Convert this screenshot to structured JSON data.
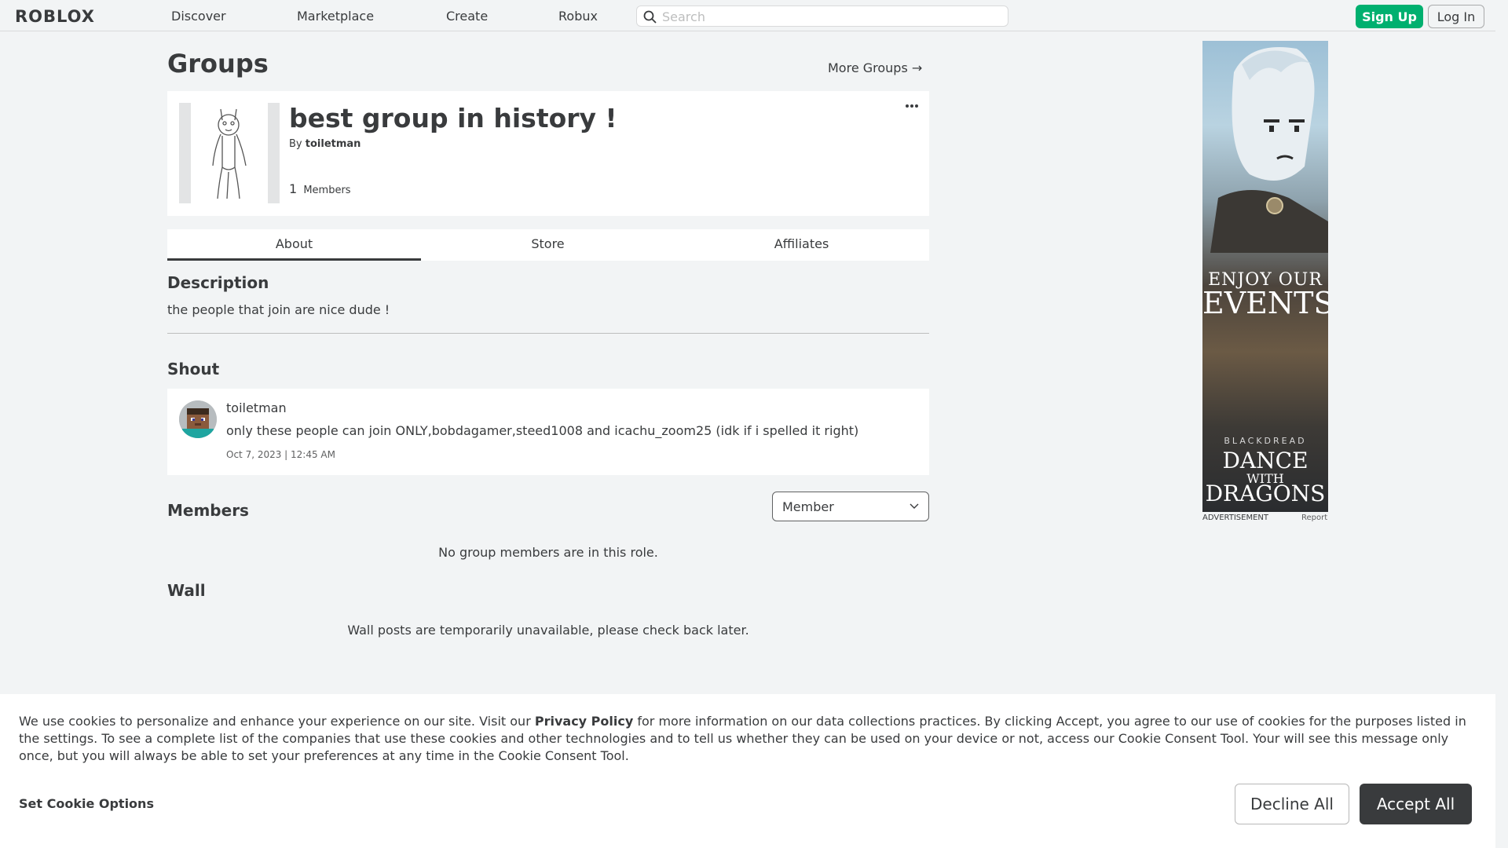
{
  "nav": {
    "logo": "ROBLOX",
    "items": [
      "Discover",
      "Marketplace",
      "Create",
      "Robux"
    ],
    "search_placeholder": "Search",
    "signup_label": "Sign Up",
    "login_label": "Log In"
  },
  "header": {
    "title": "Groups",
    "more_groups": "More Groups →"
  },
  "group": {
    "name": "best group in history !",
    "by_prefix": "By",
    "owner": "toiletman",
    "member_count": "1",
    "members_label": "Members"
  },
  "tabs": [
    {
      "label": "About",
      "active": true
    },
    {
      "label": "Store",
      "active": false
    },
    {
      "label": "Affiliates",
      "active": false
    }
  ],
  "about": {
    "description_title": "Description",
    "description": "the people that join are nice dude !",
    "shout_title": "Shout",
    "shout": {
      "user": "toiletman",
      "text": "only these people can join ONLY,bobdagamer,steed1008 and icachu_zoom25 (idk if i spelled it right)",
      "date": "Oct 7, 2023 | 12:45 AM"
    },
    "members_title": "Members",
    "role_selected": "Member",
    "members_empty": "No group members are in this role.",
    "wall_title": "Wall",
    "wall_empty": "Wall posts are temporarily unavailable, please check back later."
  },
  "ad": {
    "line1": "ENJOY OUR",
    "line2": "EVENTS",
    "brand": "BLACKDREAD",
    "line4": "DANCE",
    "line5": "WITH",
    "line6": "DRAGONS",
    "label": "ADVERTISEMENT",
    "report": "Report"
  },
  "cookie": {
    "text_before": "We use cookies to personalize and enhance your experience on our site. Visit our ",
    "link": "Privacy Policy",
    "text_after": " for more information on our data collections practices. By clicking Accept, you agree to our use of cookies for the purposes listed in the settings. To see a complete list of the companies that use these cookies and other technologies and to tell us whether they can be used on your device or not, access our Cookie Consent Tool. Your will see this message only once, but you will always be able to set your preferences at any time in the Cookie Consent Tool.",
    "set_options": "Set Cookie Options",
    "decline": "Decline All",
    "accept": "Accept All"
  },
  "colors": {
    "accent_green": "#00b06f",
    "text": "#393b3d",
    "background": "#f2f4f5"
  }
}
